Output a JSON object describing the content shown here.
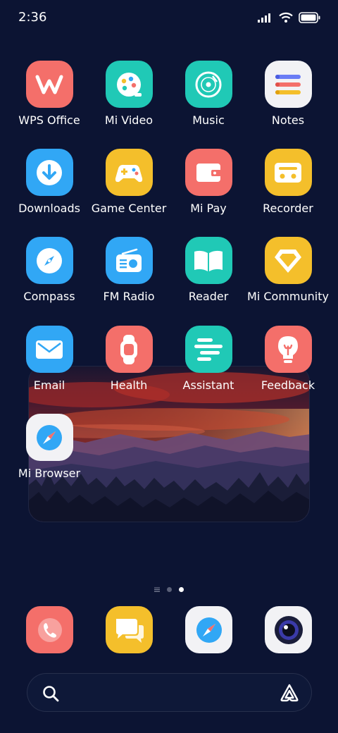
{
  "status_bar": {
    "time": "2:36",
    "icons": [
      "signal-icon",
      "wifi-icon",
      "battery-icon"
    ]
  },
  "apps": [
    {
      "name": "WPS Office",
      "icon": "wps-office-icon",
      "color": "#f46f6a"
    },
    {
      "name": "Mi Video",
      "icon": "mi-video-icon",
      "color": "#20c9b6"
    },
    {
      "name": "Music",
      "icon": "music-icon",
      "color": "#20c9b6"
    },
    {
      "name": "Notes",
      "icon": "notes-icon",
      "color": "#f2f2f5"
    },
    {
      "name": "Downloads",
      "icon": "downloads-icon",
      "color": "#31a7f5"
    },
    {
      "name": "Game Center",
      "icon": "game-center-icon",
      "color": "#f4bf2b"
    },
    {
      "name": "Mi Pay",
      "icon": "mi-pay-icon",
      "color": "#f46f6a"
    },
    {
      "name": "Recorder",
      "icon": "recorder-icon",
      "color": "#f4bf2b"
    },
    {
      "name": "Compass",
      "icon": "compass-icon",
      "color": "#31a7f5"
    },
    {
      "name": "FM Radio",
      "icon": "fm-radio-icon",
      "color": "#31a7f5"
    },
    {
      "name": "Reader",
      "icon": "reader-icon",
      "color": "#20c9b6"
    },
    {
      "name": "Mi Community",
      "icon": "mi-community-icon",
      "color": "#f4bf2b"
    },
    {
      "name": "Email",
      "icon": "email-icon",
      "color": "#31a7f5"
    },
    {
      "name": "Health",
      "icon": "health-icon",
      "color": "#f46f6a"
    },
    {
      "name": "Assistant",
      "icon": "assistant-icon",
      "color": "#20c9b6"
    },
    {
      "name": "Feedback",
      "icon": "feedback-icon",
      "color": "#f46f6a"
    },
    {
      "name": "Mi Browser",
      "icon": "mi-browser-icon",
      "color": "#f2f2f5"
    }
  ],
  "page_indicator": {
    "pages": 2,
    "active": 2
  },
  "dock": [
    {
      "icon": "phone-icon",
      "color": "#f46f6a"
    },
    {
      "icon": "messaging-icon",
      "color": "#f4bf2b"
    },
    {
      "icon": "browser-icon",
      "color": "#f2f2f5"
    },
    {
      "icon": "camera-icon",
      "color": "#f2f2f5"
    }
  ],
  "search": {
    "value": "",
    "placeholder": ""
  },
  "colors": {
    "background": "#0c1433",
    "accent_red": "#f46f6a",
    "accent_teal": "#20c9b6",
    "accent_blue": "#31a7f5",
    "accent_yellow": "#f4bf2b"
  }
}
